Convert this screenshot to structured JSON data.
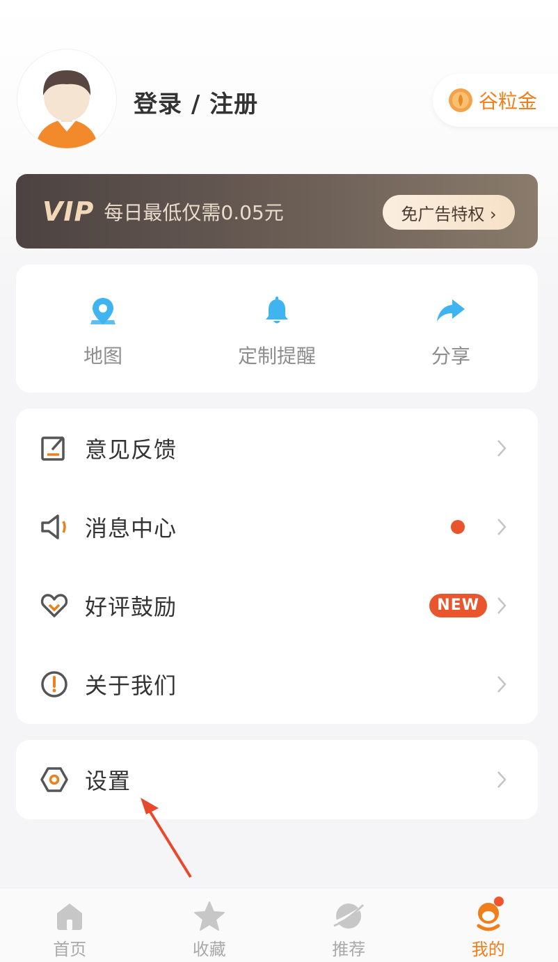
{
  "header": {
    "login_label": "登录 / 注册",
    "coin_label": "谷粒金"
  },
  "vip": {
    "logo": "VIP",
    "text": "每日最低仅需0.05元",
    "button": "免广告特权 ›"
  },
  "quick_actions": [
    {
      "label": "地图",
      "icon": "map-pin-icon"
    },
    {
      "label": "定制提醒",
      "icon": "bell-icon"
    },
    {
      "label": "分享",
      "icon": "share-icon"
    }
  ],
  "menu": {
    "items": [
      {
        "label": "意见反馈",
        "icon": "edit-icon"
      },
      {
        "label": "消息中心",
        "icon": "speaker-icon"
      },
      {
        "label": "好评鼓励",
        "icon": "heart-icon",
        "badge": "NEW"
      },
      {
        "label": "关于我们",
        "icon": "info-icon"
      }
    ],
    "settings": {
      "label": "设置",
      "icon": "settings-icon"
    }
  },
  "tabs": [
    {
      "label": "首页",
      "icon": "home-icon"
    },
    {
      "label": "收藏",
      "icon": "star-icon"
    },
    {
      "label": "推荐",
      "icon": "planet-icon"
    },
    {
      "label": "我的",
      "icon": "profile-icon",
      "active": true
    }
  ],
  "colors": {
    "accent": "#f07f1b",
    "quick_icon": "#3fb4f0",
    "badge": "#e9562e"
  }
}
